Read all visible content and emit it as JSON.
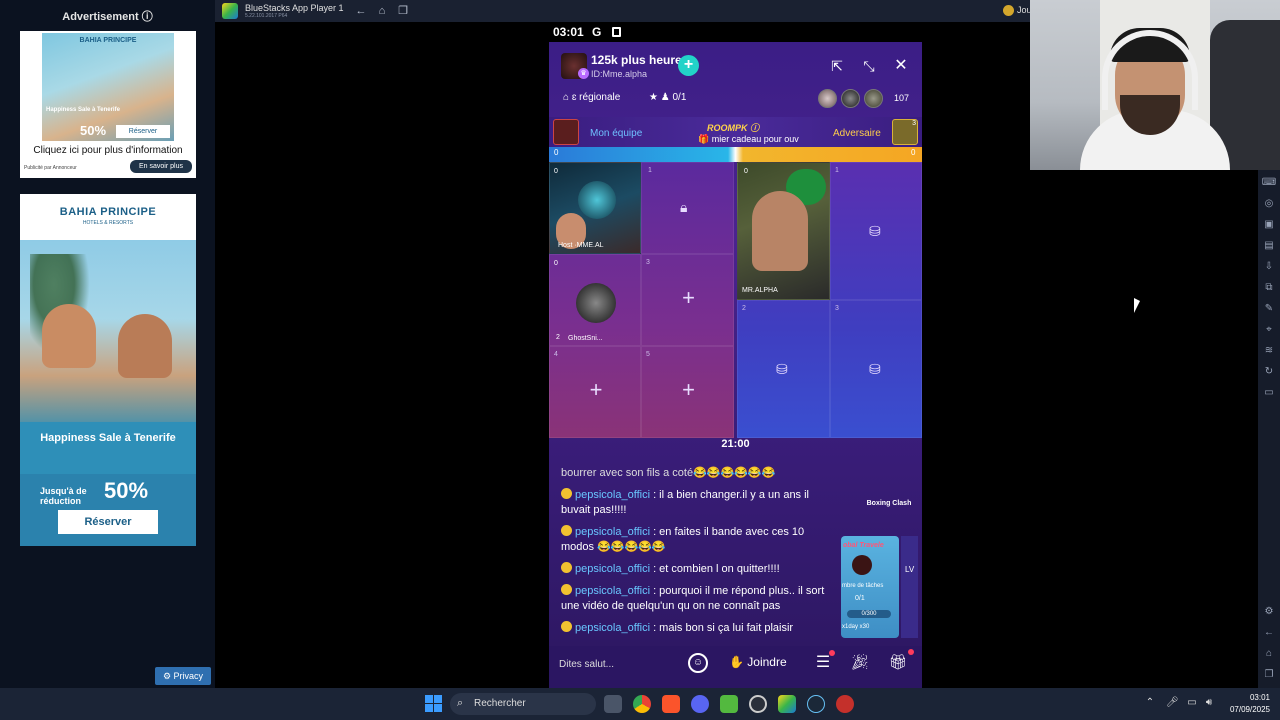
{
  "ads": {
    "title": "Advertisement ⓘ",
    "ad1": {
      "logo": "BAHIA PRINCIPE",
      "sale": "Happiness Sale à Tenerife",
      "reduc_small": "Jusqu'à de réduction",
      "percent": "50%",
      "reserve": "Réserver",
      "cta": "Cliquez ici pour plus d'information",
      "publisher": "Publicité par Annonceur",
      "more": "En savoir plus"
    },
    "ad2": {
      "logo": "BAHIA PRINCIPE",
      "logo_sub": "HOTELS & RESORTS",
      "headline": "Happiness Sale à Tenerife",
      "reduc": "Jusqu'à de réduction",
      "percent": "50%",
      "reserve": "Réserver"
    },
    "privacy": "Privacy"
  },
  "window": {
    "title": "BlueStacks App Player 1",
    "version": "5.22.101.2017 P64",
    "account": "Jou"
  },
  "phone": {
    "status": {
      "time": "03:01",
      "g": "G"
    },
    "host": {
      "name": "125k plus heure",
      "id": "ID:Mme.alpha",
      "follow": "+"
    },
    "region": "⌂ ɛ régionale",
    "stars": "★ ♟ 0/1",
    "viewer_count": "107",
    "pk": {
      "my_team": "Mon équipe",
      "logo": "ROOMPK ⓘ",
      "gift_text": "mier cadeau pour ouv",
      "adversary": "Adversaire",
      "left_score": "0",
      "right_score": "0",
      "adv_badge": "3"
    },
    "left_seats": [
      {
        "num": "",
        "label": "Host ·MME.AL",
        "score": "0"
      },
      {
        "num": "1",
        "label": "",
        "score": ""
      },
      {
        "num": "2",
        "label": "GhostSni...",
        "score": "0"
      },
      {
        "num": "3",
        "label": "",
        "score": ""
      },
      {
        "num": "4",
        "label": "",
        "score": ""
      },
      {
        "num": "5",
        "label": "",
        "score": ""
      }
    ],
    "right_seats": [
      {
        "num": "",
        "label": "MR.ALPHA",
        "score": "0"
      },
      {
        "num": "1",
        "label": "",
        "score": ""
      },
      {
        "num": "2",
        "label": "",
        "score": ""
      },
      {
        "num": "3",
        "label": "",
        "score": ""
      }
    ],
    "timer": "21:00",
    "chat": [
      {
        "user": "",
        "text": "bourrer avec son fils a coté😂😂😂😂😂😂"
      },
      {
        "user": "pepsicola_offici",
        "text": " : il a bien changer.il y a un ans il buvait pas!!!!!"
      },
      {
        "user": "pepsicola_offici",
        "text": " : en faites il bande avec ces 10 modos 😂😂😂😂😂"
      },
      {
        "user": "pepsicola_offici",
        "text": " : et combien l on quitter!!!!"
      },
      {
        "user": "pepsicola_offici",
        "text": " : pourquoi il me répond plus..  il sort une vidéo de quelqu'un qu on ne connaît pas"
      },
      {
        "user": "pepsicola_offici",
        "text": " : mais bon si ça lui fait plaisir"
      }
    ],
    "event": {
      "boxing": "Boxing Clash",
      "title": "obal Travele",
      "sub": "mbre de tâches",
      "count": "0/1",
      "progress": "0/300",
      "time": "x1day  x30",
      "lv": "LV"
    },
    "bottom": {
      "placeholder": "Dites salut...",
      "join": "✋ Joindre"
    }
  },
  "taskbar": {
    "search": "Rechercher",
    "time": "03:01",
    "date": "07/09/2025"
  }
}
